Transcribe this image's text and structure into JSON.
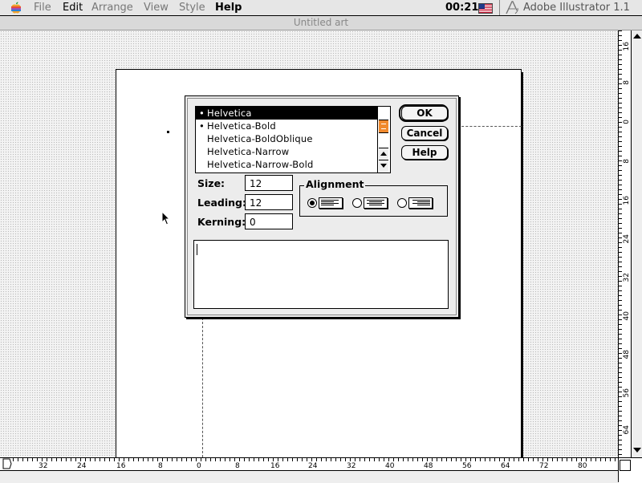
{
  "menubar": {
    "items": [
      {
        "label": "File",
        "dim": true
      },
      {
        "label": "Edit",
        "dim": false
      },
      {
        "label": "Arrange",
        "dim": true
      },
      {
        "label": "View",
        "dim": true
      },
      {
        "label": "Style",
        "dim": true
      },
      {
        "label": "Help",
        "dim": false
      }
    ],
    "clock": "00:21",
    "app_name": "Adobe Illustrator 1.1"
  },
  "window": {
    "title": "Untitled art"
  },
  "vruler": {
    "labels": [
      "16",
      "8",
      "0",
      "8",
      "16",
      "24",
      "32",
      "40",
      "48",
      "56",
      "64"
    ]
  },
  "hruler": {
    "labels": [
      "32",
      "24",
      "16",
      "8",
      "0",
      "8",
      "16",
      "24",
      "32",
      "40",
      "48",
      "56",
      "64",
      "72",
      "80"
    ]
  },
  "dialog": {
    "fonts": [
      {
        "name": "Helvetica",
        "marked": true,
        "selected": true
      },
      {
        "name": "Helvetica-Bold",
        "marked": true,
        "selected": false
      },
      {
        "name": "Helvetica-BoldOblique",
        "marked": false,
        "selected": false
      },
      {
        "name": "Helvetica-Narrow",
        "marked": false,
        "selected": false
      },
      {
        "name": "Helvetica-Narrow-Bold",
        "marked": false,
        "selected": false
      }
    ],
    "buttons": {
      "ok": "OK",
      "cancel": "Cancel",
      "help": "Help"
    },
    "size": {
      "label": "Size:",
      "value": "12"
    },
    "leading": {
      "label": "Leading:",
      "value": "12"
    },
    "kerning": {
      "label": "Kerning:",
      "value": "0"
    },
    "alignment": {
      "label": "Alignment",
      "options": [
        {
          "name": "left",
          "selected": true
        },
        {
          "name": "center",
          "selected": false
        },
        {
          "name": "right",
          "selected": false
        }
      ]
    },
    "text": ""
  },
  "colors": {
    "scroll_thumb": "#f08a2e",
    "flag_red": "#c8102e",
    "flag_blue": "#1e3a8a"
  }
}
